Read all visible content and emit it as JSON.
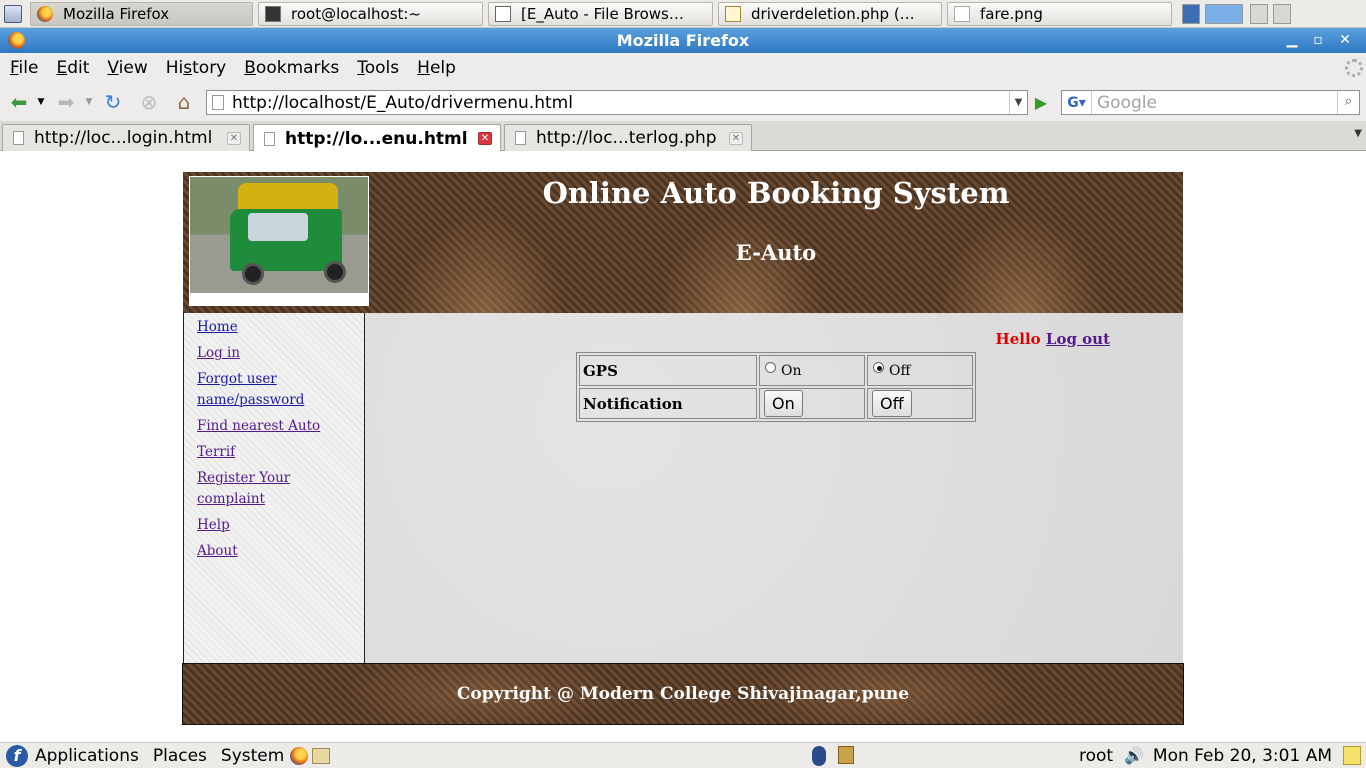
{
  "taskbar": {
    "tasks": [
      {
        "label": "Mozilla Firefox"
      },
      {
        "label": "root@localhost:~"
      },
      {
        "label": "[E_Auto - File Brows…"
      },
      {
        "label": "driverdeletion.php (…"
      },
      {
        "label": "fare.png"
      }
    ]
  },
  "window": {
    "title": "Mozilla Firefox"
  },
  "menubar": {
    "items": [
      {
        "label": "File",
        "key": "F",
        "rest": "ile"
      },
      {
        "label": "Edit",
        "key": "E",
        "rest": "dit"
      },
      {
        "label": "View",
        "key": "V",
        "rest": "iew"
      },
      {
        "label": "History",
        "pre": "Hi",
        "key": "s",
        "rest": "tory"
      },
      {
        "label": "Bookmarks",
        "key": "B",
        "rest": "ookmarks"
      },
      {
        "label": "Tools",
        "key": "T",
        "rest": "ools"
      },
      {
        "label": "Help",
        "key": "H",
        "rest": "elp"
      }
    ]
  },
  "navbar": {
    "url": "http://localhost/E_Auto/drivermenu.html",
    "search_placeholder": "Google"
  },
  "tabs": [
    {
      "label": "http://loc...login.html",
      "selected": false
    },
    {
      "label": "http://lo...enu.html",
      "selected": true
    },
    {
      "label": "http://loc...terlog.php",
      "selected": false
    }
  ],
  "page": {
    "header_title": "Online Auto Booking System",
    "header_subtitle": "E-Auto",
    "sidebar_links": [
      {
        "label": "Home"
      },
      {
        "label": "Log in"
      },
      {
        "label": "Forgot user name/password"
      },
      {
        "label": "Find nearest Auto"
      },
      {
        "label": "Terrif"
      },
      {
        "label": "Register Your complaint"
      },
      {
        "label": "Help"
      },
      {
        "label": "About"
      }
    ],
    "hello_text": "Hello",
    "logout_label": "Log out",
    "controls": {
      "gps_label": "GPS",
      "gps_on": "On",
      "gps_off": "Off",
      "gps_selected": "Off",
      "notification_label": "Notification",
      "notif_on": "On",
      "notif_off": "Off"
    },
    "footer": "Copyright @ Modern College Shivajinagar,pune"
  },
  "bottom_panel": {
    "applications": "Applications",
    "places": "Places",
    "system": "System",
    "user": "root",
    "clock": "Mon Feb 20,  3:01 AM"
  }
}
